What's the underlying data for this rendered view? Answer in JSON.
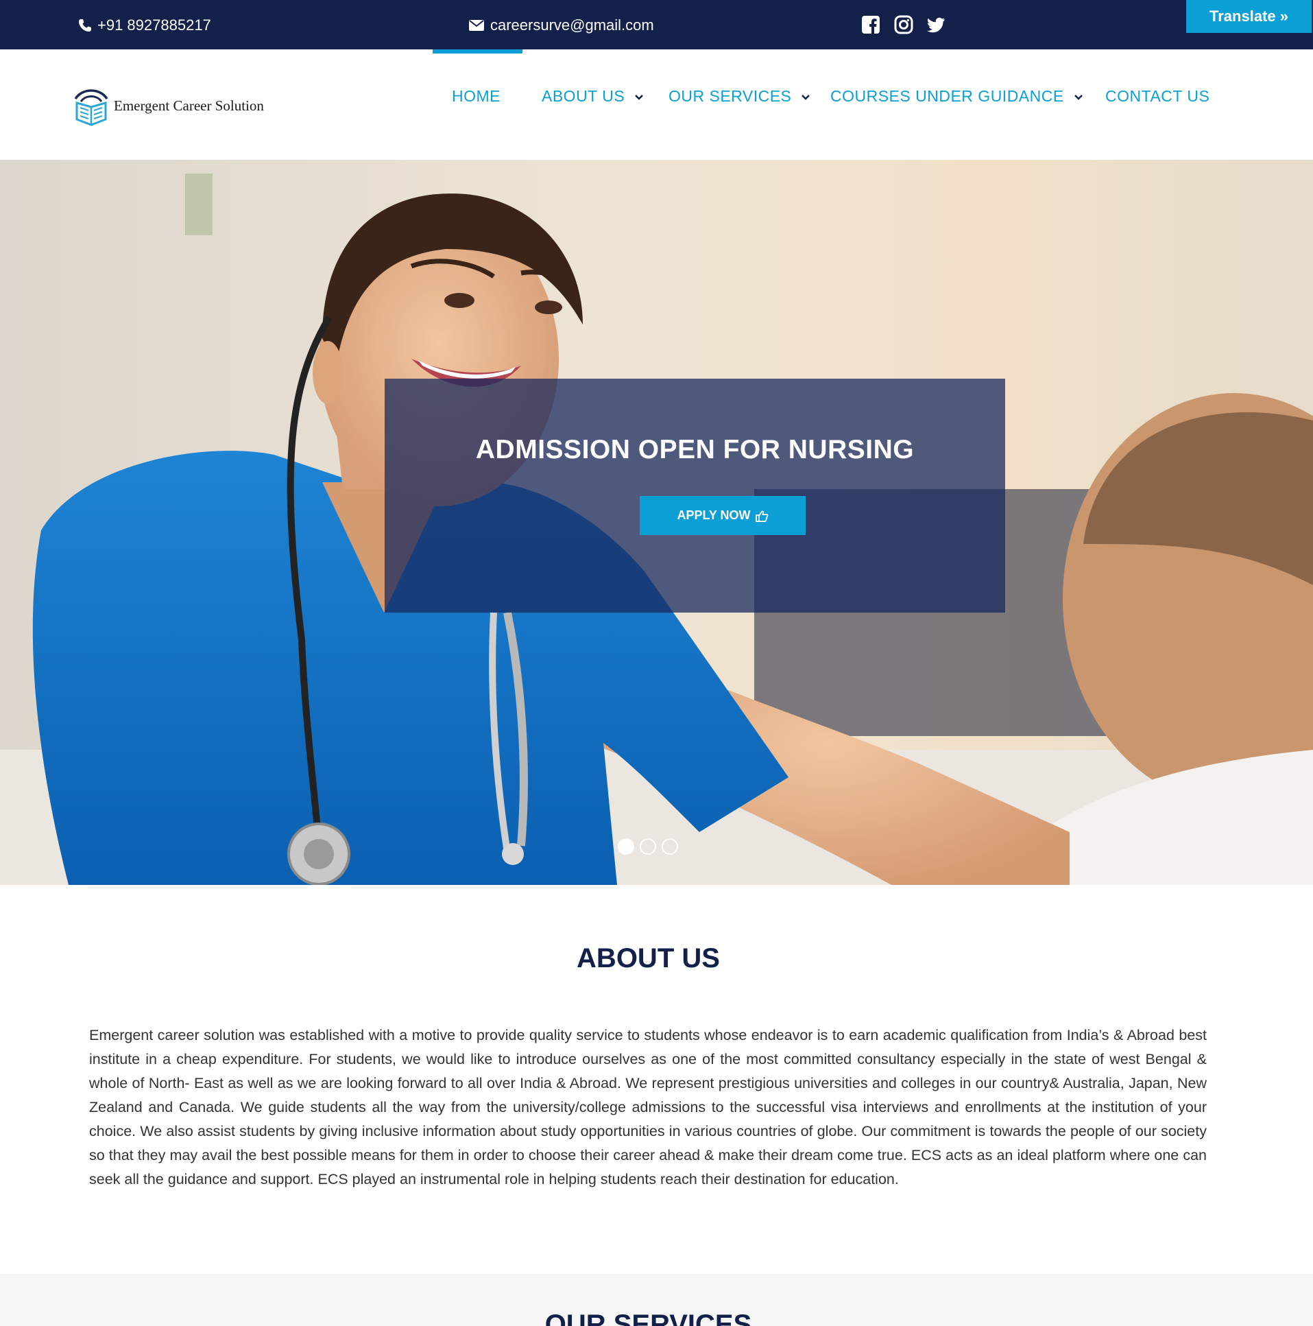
{
  "topbar": {
    "phone": "+91 8927885217",
    "email": "careersurve@gmail.com",
    "social": [
      "facebook-icon",
      "instagram-icon",
      "twitter-icon"
    ],
    "translate_label": "Translate »"
  },
  "brand": {
    "name": "Emergent Career Solution"
  },
  "nav": {
    "items": [
      {
        "label": "HOME",
        "active": true,
        "dropdown": false
      },
      {
        "label": "ABOUT US",
        "dropdown": true
      },
      {
        "label": "OUR SERVICES",
        "dropdown": true
      },
      {
        "label": "COURSES UNDER GUIDANCE",
        "dropdown": true
      },
      {
        "label": "CONTACT US",
        "dropdown": false
      }
    ]
  },
  "hero": {
    "title": "ADMISSION OPEN FOR NURSING",
    "button_label": "APPLY NOW",
    "slides_total": 3,
    "active_slide": 1
  },
  "about": {
    "title": "ABOUT US",
    "text": "Emergent career solution was established with a motive to provide quality service to students whose endeavor is to earn academic qualification from India’s & Abroad best institute in a cheap expenditure. For students, we would like to introduce ourselves as one of the most committed consultancy especially in the state of west Bengal & whole of North- East as well as we are looking forward to all over India & Abroad. We represent prestigious universities and colleges in our country& Australia, Japan, New Zealand and Canada. We guide students all the way from the university/college admissions to the successful visa interviews and enrollments at the institution of your choice. We also assist students by giving inclusive information about study opportunities in various countries of globe. Our commitment is towards the people of our society so that they may avail the best possible means for them in order to choose their career ahead & make their dream come true. ECS acts as an ideal platform where one can seek all the guidance and support. ECS played an instrumental role in helping students reach their destination for education."
  },
  "services": {
    "title": "OUR SERVICES"
  },
  "colors": {
    "navy": "#13204a",
    "accent": "#0b9fd6"
  }
}
